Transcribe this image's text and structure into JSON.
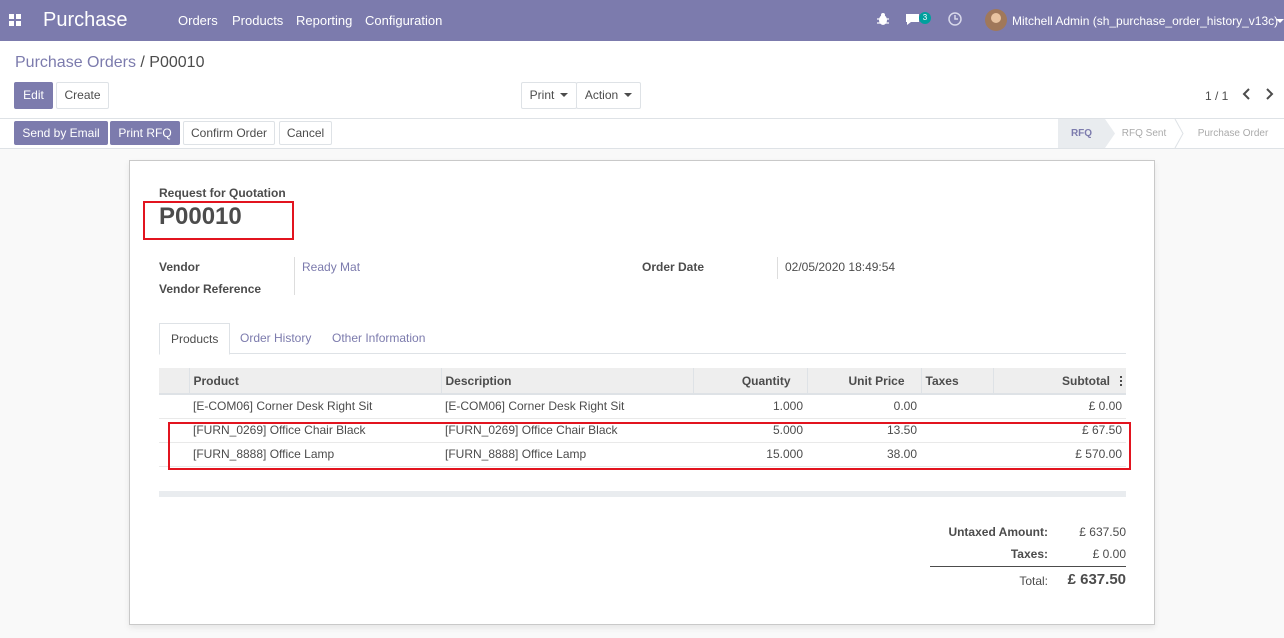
{
  "navbar": {
    "app_name": "Purchase",
    "menu": [
      "Orders",
      "Products",
      "Reporting",
      "Configuration"
    ],
    "messages_count": "3",
    "user": "Mitchell Admin (sh_purchase_order_history_v13c)"
  },
  "breadcrumb": {
    "parent": "Purchase Orders",
    "separator": "/",
    "current": "P00010"
  },
  "buttons": {
    "edit": "Edit",
    "create": "Create",
    "print": "Print",
    "action": "Action",
    "send_email": "Send by Email",
    "print_rfq": "Print RFQ",
    "confirm": "Confirm Order",
    "cancel": "Cancel"
  },
  "pager": {
    "value": "1 / 1"
  },
  "stages": [
    "RFQ",
    "RFQ Sent",
    "Purchase Order"
  ],
  "active_stage": "RFQ",
  "form": {
    "subtitle": "Request for Quotation",
    "name": "P00010",
    "vendor_label": "Vendor",
    "vendor": "Ready Mat",
    "vendor_ref_label": "Vendor Reference",
    "vendor_ref": "",
    "order_date_label": "Order Date",
    "order_date": "02/05/2020 18:49:54"
  },
  "tabs": [
    "Products",
    "Order History",
    "Other Information"
  ],
  "active_tab": "Products",
  "table": {
    "headers": [
      "Product",
      "Description",
      "Quantity",
      "Unit Price",
      "Taxes",
      "Subtotal"
    ],
    "rows": [
      {
        "product": "[E-COM06] Corner Desk Right Sit",
        "description": "[E-COM06] Corner Desk Right Sit",
        "quantity": "1.000",
        "unit_price": "0.00",
        "taxes": "",
        "subtotal": "£ 0.00"
      },
      {
        "product": "[FURN_0269] Office Chair Black",
        "description": "[FURN_0269] Office Chair Black",
        "quantity": "5.000",
        "unit_price": "13.50",
        "taxes": "",
        "subtotal": "£ 67.50"
      },
      {
        "product": "[FURN_8888] Office Lamp",
        "description": "[FURN_8888] Office Lamp",
        "quantity": "15.000",
        "unit_price": "38.00",
        "taxes": "",
        "subtotal": "£ 570.00"
      }
    ]
  },
  "totals": {
    "untaxed_label": "Untaxed Amount:",
    "untaxed": "£ 637.50",
    "taxes_label": "Taxes:",
    "taxes": "£ 0.00",
    "total_label": "Total:",
    "total": "£ 637.50"
  },
  "colors": {
    "brand": "#7c7bad",
    "highlight": "#e2141f"
  }
}
